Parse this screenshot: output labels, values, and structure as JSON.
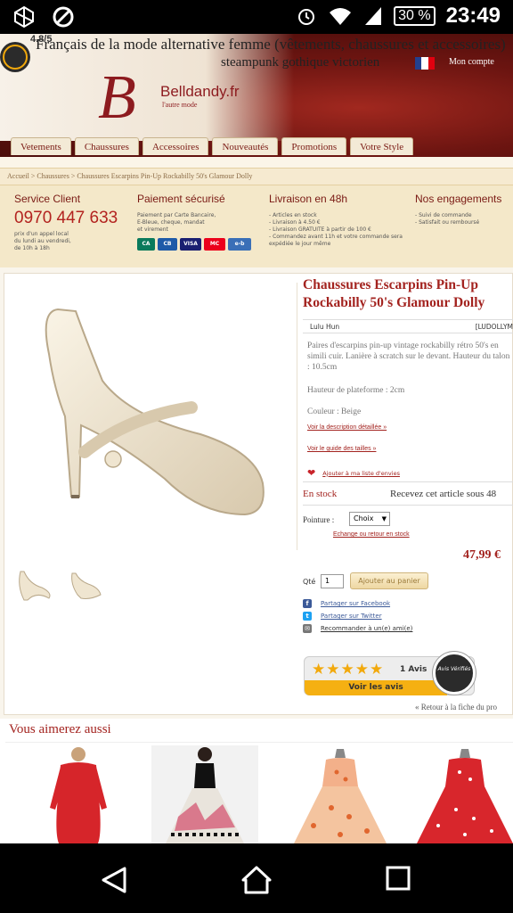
{
  "status_bar": {
    "battery": "30 %",
    "clock": "23:49"
  },
  "header": {
    "rating_score": "4.8/5",
    "tagline": "Français de la mode alternative femme (vêtements, chaussures et accessoires)",
    "tagline_sub": "steampunk gothique victorien",
    "logo_name": "Belldandy.fr",
    "logo_sub": "l'autre mode",
    "account": "Mon compte",
    "nav": [
      "Vetements",
      "Chaussures",
      "Accessoires",
      "Nouveautés",
      "Promotions",
      "Votre Style"
    ]
  },
  "breadcrumb": "Accueil > Chaussures > Chaussures Escarpins Pin-Up Rockabilly 50's Glamour Dolly",
  "info": {
    "service_title": "Service Client",
    "phone": "0970 447 633",
    "service_lines": [
      "prix d'un appel local",
      "du lundi au vendredi,",
      "de 10h à 18h"
    ],
    "payment_title": "Paiement sécurisé",
    "payment_lines": [
      "Paiement par Carte Bancaire,",
      "E-Bleue, cheque, mandat",
      "et virement"
    ],
    "delivery_title": "Livraison en 48h",
    "delivery_lines": [
      "- Articles en stock",
      "- Livraison à 4.50 €",
      "- Livraison GRATUITE à partir de 100 €",
      "- Commandez avant 11h et votre commande sera",
      "  expédiée le jour même"
    ],
    "commit_title": "Nos engagements",
    "commit_lines": [
      "- Suivi de commande",
      "- Satisfait ou remboursé"
    ]
  },
  "product": {
    "title": "Chaussures Escarpins Pin-Up Rockabilly 50's Glamour Dolly",
    "brand": "Lulu Hun",
    "ref": "[LUDOLLYM",
    "desc1": "Paires d'escarpins pin-up vintage rockabilly rétro 50's en simili cuir. Lanière à scratch sur le devant. Hauteur du talon : 10.5cm",
    "desc2": "Hauteur de plateforme : 2cm",
    "desc3": "Couleur : Beige",
    "link_desc": "Voir la description détaillée »",
    "link_sizes": "Voir le guide des tailles »",
    "wishlist": "Ajouter à ma liste d'envies",
    "stock": "En stock",
    "delivery": "Recevez cet article sous 48",
    "size_label": "Pointure :",
    "size_value": "Choix",
    "return_link": "Echange ou retour en stock",
    "price": "47,99 €",
    "qty_label": "Qté",
    "qty_value": "1",
    "cart_button": "Ajouter au panier",
    "share_fb": "Partager sur Facebook",
    "share_tw": "Partager sur Twitter",
    "share_mail": "Recommander à un(e) ami(e)",
    "reviews_count": "1 Avis",
    "reviews_button": "Voir les avis",
    "reviews_seal": "Avis Vérifiés",
    "rating_stars": 5,
    "back_link": "« Retour à la fiche du pro"
  },
  "recommend": {
    "title": "Vous aimerez aussi"
  },
  "colors": {
    "brand_red": "#a3231f",
    "strip": "#f4e8c9",
    "star": "#f2a90c"
  }
}
